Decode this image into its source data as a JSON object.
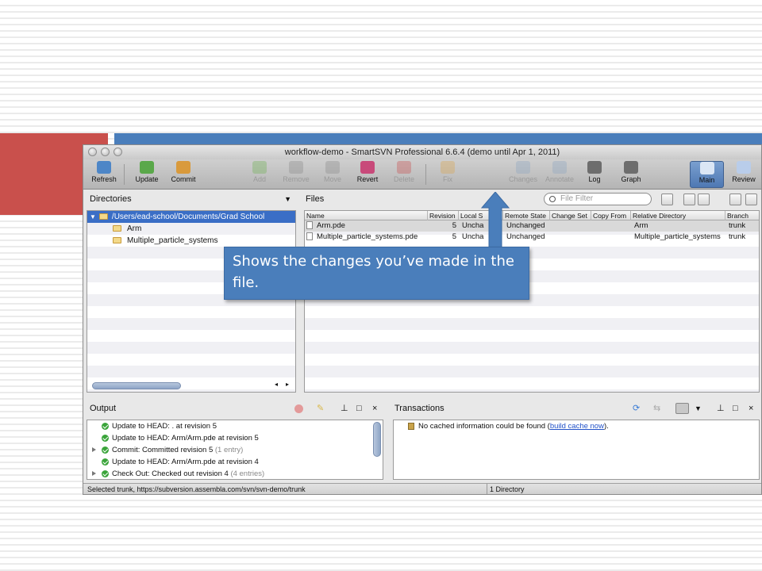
{
  "window": {
    "title": "workflow-demo - SmartSVN Professional 6.6.4 (demo until Apr 1, 2011)"
  },
  "toolbar": [
    {
      "id": "refresh",
      "label": "Refresh",
      "icon": "refresh-icon",
      "enabled": true
    },
    {
      "id": "update",
      "label": "Update",
      "icon": "update-icon",
      "enabled": true
    },
    {
      "id": "commit",
      "label": "Commit",
      "icon": "commit-icon",
      "enabled": true
    },
    {
      "id": "add",
      "label": "Add",
      "icon": "add-icon",
      "enabled": false
    },
    {
      "id": "remove",
      "label": "Remove",
      "icon": "remove-icon",
      "enabled": false
    },
    {
      "id": "move",
      "label": "Move",
      "icon": "move-icon",
      "enabled": false
    },
    {
      "id": "revert",
      "label": "Revert",
      "icon": "revert-icon",
      "enabled": true
    },
    {
      "id": "delete",
      "label": "Delete",
      "icon": "delete-icon",
      "enabled": false
    },
    {
      "id": "fix",
      "label": "Fix",
      "icon": "fix-icon",
      "enabled": false
    },
    {
      "id": "changes",
      "label": "Changes",
      "icon": "changes-icon",
      "enabled": false
    },
    {
      "id": "annotate",
      "label": "Annotate",
      "icon": "annotate-icon",
      "enabled": false
    },
    {
      "id": "log",
      "label": "Log",
      "icon": "log-icon",
      "enabled": true
    },
    {
      "id": "graph",
      "label": "Graph",
      "icon": "graph-icon",
      "enabled": true
    },
    {
      "id": "main",
      "label": "Main",
      "icon": "main-layout-icon",
      "enabled": true
    },
    {
      "id": "review",
      "label": "Review",
      "icon": "review-layout-icon",
      "enabled": true
    }
  ],
  "directories": {
    "header": "Directories",
    "items": [
      "/Users/ead-school/Documents/Grad School",
      "Arm",
      "Multiple_particle_systems"
    ]
  },
  "files": {
    "header": "Files",
    "filter_placeholder": "File Filter",
    "columns": [
      "Name",
      "Revision",
      "Local S",
      "Remote State",
      "Change Set",
      "Copy From",
      "Relative Directory",
      "Branch"
    ],
    "rows": [
      {
        "name": "Arm.pde",
        "revision": "5",
        "local": "Uncha",
        "remote": "Unchanged",
        "changeset": "",
        "copyfrom": "",
        "reldir": "Arm",
        "branch": "trunk"
      },
      {
        "name": "Multiple_particle_systems.pde",
        "revision": "5",
        "local": "Uncha",
        "remote": "Unchanged",
        "changeset": "",
        "copyfrom": "",
        "reldir": "Multiple_particle_systems",
        "branch": "trunk"
      }
    ]
  },
  "callout": {
    "text": "Shows the changes you’ve made in the file."
  },
  "output": {
    "header": "Output",
    "rows": [
      {
        "text": "Update to HEAD: . at revision 5",
        "extra": "",
        "expandable": false
      },
      {
        "text": "Update to HEAD: Arm/Arm.pde at revision 5",
        "extra": "",
        "expandable": false
      },
      {
        "text": "Commit: Committed revision 5",
        "extra": "(1 entry)",
        "expandable": true
      },
      {
        "text": "Update to HEAD: Arm/Arm.pde at revision 4",
        "extra": "",
        "expandable": false
      },
      {
        "text": "Check Out: Checked out revision 4",
        "extra": "(4 entries)",
        "expandable": true
      }
    ]
  },
  "transactions": {
    "header": "Transactions",
    "message": "No cached information could be found (",
    "link": "build cache now",
    "message_end": ")."
  },
  "status": {
    "left": "Selected trunk, https://subversion.assembla.com/svn/svn-demo/trunk",
    "right": "1 Directory"
  },
  "colors": {
    "accent_red": "#c9504c",
    "accent_blue": "#4a7ebb",
    "selection": "#3a6ec6"
  }
}
